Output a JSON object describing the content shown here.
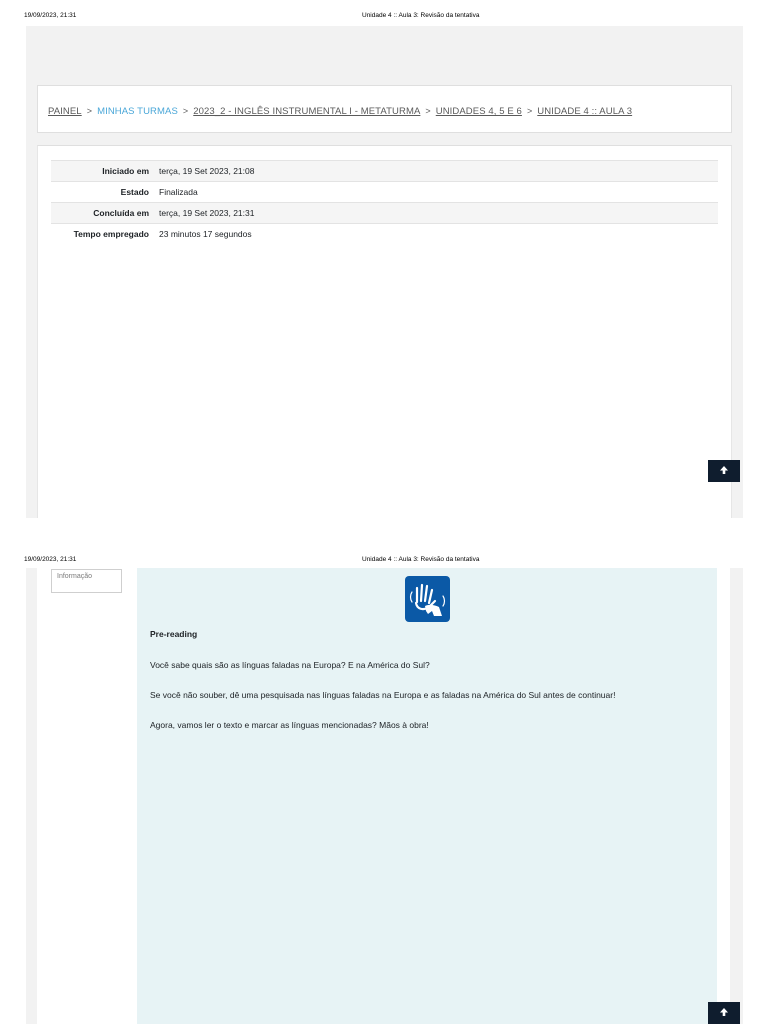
{
  "print_header": {
    "timestamp": "19/09/2023, 21:31",
    "page_title": "Unidade 4 :: Aula 3: Revisão da tentativa"
  },
  "breadcrumb": [
    {
      "label": "PAINEL"
    },
    {
      "label": "MINHAS TURMAS"
    },
    {
      "label": "2023_2 - INGLÊS INSTRUMENTAL I - METATURMA"
    },
    {
      "label": "UNIDADES 4, 5 E 6"
    },
    {
      "label": "UNIDADE 4 :: AULA 3"
    }
  ],
  "breadcrumb_separator": ">",
  "summary": [
    {
      "label": "Iniciado em",
      "value": "terça, 19 Set 2023, 21:08"
    },
    {
      "label": "Estado",
      "value": "Finalizada"
    },
    {
      "label": "Concluída em",
      "value": "terça, 19 Set 2023, 21:31"
    },
    {
      "label": "Tempo empregado",
      "value": "23 minutos 17 segundos"
    }
  ],
  "back_to_top_icon": "arrow-up-icon",
  "info_box": {
    "label": "Informação"
  },
  "question": {
    "icon": "sign-language-icon",
    "heading": "Pre-reading",
    "paragraphs": [
      "Você sabe quais são as línguas faladas na Europa? E na América do Sul?",
      "Se você não souber, dê uma pesquisada nas línguas faladas na Europa e as faladas na América do Sul antes de continuar!",
      "Agora, vamos ler o texto e marcar as línguas mencionadas? Mãos à obra!"
    ]
  },
  "colors": {
    "breadcrumb_current": "#4aa7d8",
    "back_to_top_bg": "#0f1d2e",
    "question_bg": "#e7f3f5",
    "icon_bg": "#0b59a6"
  }
}
